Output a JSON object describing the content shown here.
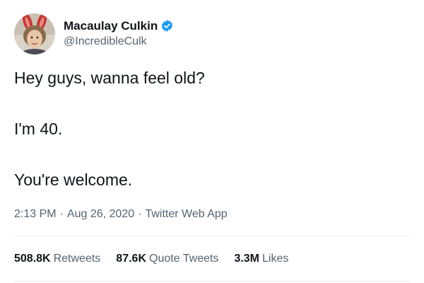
{
  "colors": {
    "text": "#0f1419",
    "secondary": "#536471",
    "verified": "#1d9bf0",
    "divider": "#e6ecf0"
  },
  "author": {
    "display_name": "Macaulay Culkin",
    "handle": "@IncredibleCulk",
    "avatar_icon": "profile-photo",
    "verified_icon": "verified-badge-icon"
  },
  "tweet": {
    "lines": [
      "Hey guys, wanna feel old?",
      "I'm 40.",
      "You're welcome."
    ],
    "time": "2:13 PM",
    "date": "Aug 26, 2020",
    "source": "Twitter Web App",
    "separator": "·"
  },
  "stats": {
    "retweets": {
      "count": "508.8K",
      "label": "Retweets"
    },
    "quote_tweets": {
      "count": "87.6K",
      "label": "Quote Tweets"
    },
    "likes": {
      "count": "3.3M",
      "label": "Likes"
    }
  }
}
